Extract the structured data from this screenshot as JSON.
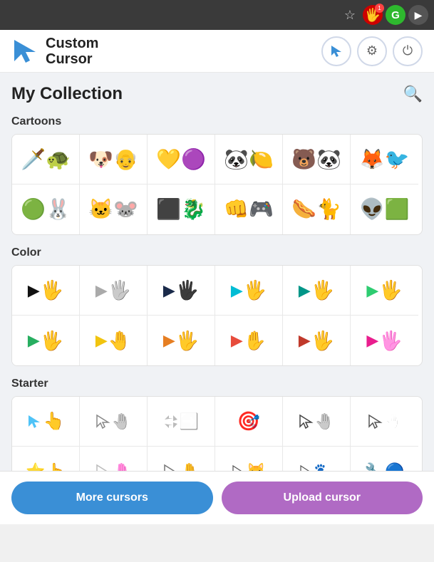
{
  "browser": {
    "icons": [
      {
        "name": "star",
        "symbol": "☆"
      },
      {
        "name": "red-extension",
        "symbol": "🖐",
        "badge": "1"
      },
      {
        "name": "green-extension",
        "symbol": "G"
      },
      {
        "name": "play-extension",
        "symbol": "▶"
      }
    ]
  },
  "header": {
    "logo_line1": "Custom",
    "logo_line2": "Cursor",
    "buttons": {
      "cursor_btn": "↖",
      "settings_btn": "⚙",
      "power_btn": "⏻"
    }
  },
  "page": {
    "title": "My Collection",
    "search_tooltip": "Search"
  },
  "sections": [
    {
      "id": "cartoons",
      "title": "Cartoons",
      "rows": 2,
      "cells_per_row": 6
    },
    {
      "id": "color",
      "title": "Color",
      "rows": 2,
      "cells_per_row": 6
    },
    {
      "id": "starter",
      "title": "Starter",
      "rows": 2,
      "cells_per_row": 6
    }
  ],
  "buttons": {
    "more_cursors": "More cursors",
    "upload_cursor": "Upload cursor"
  }
}
